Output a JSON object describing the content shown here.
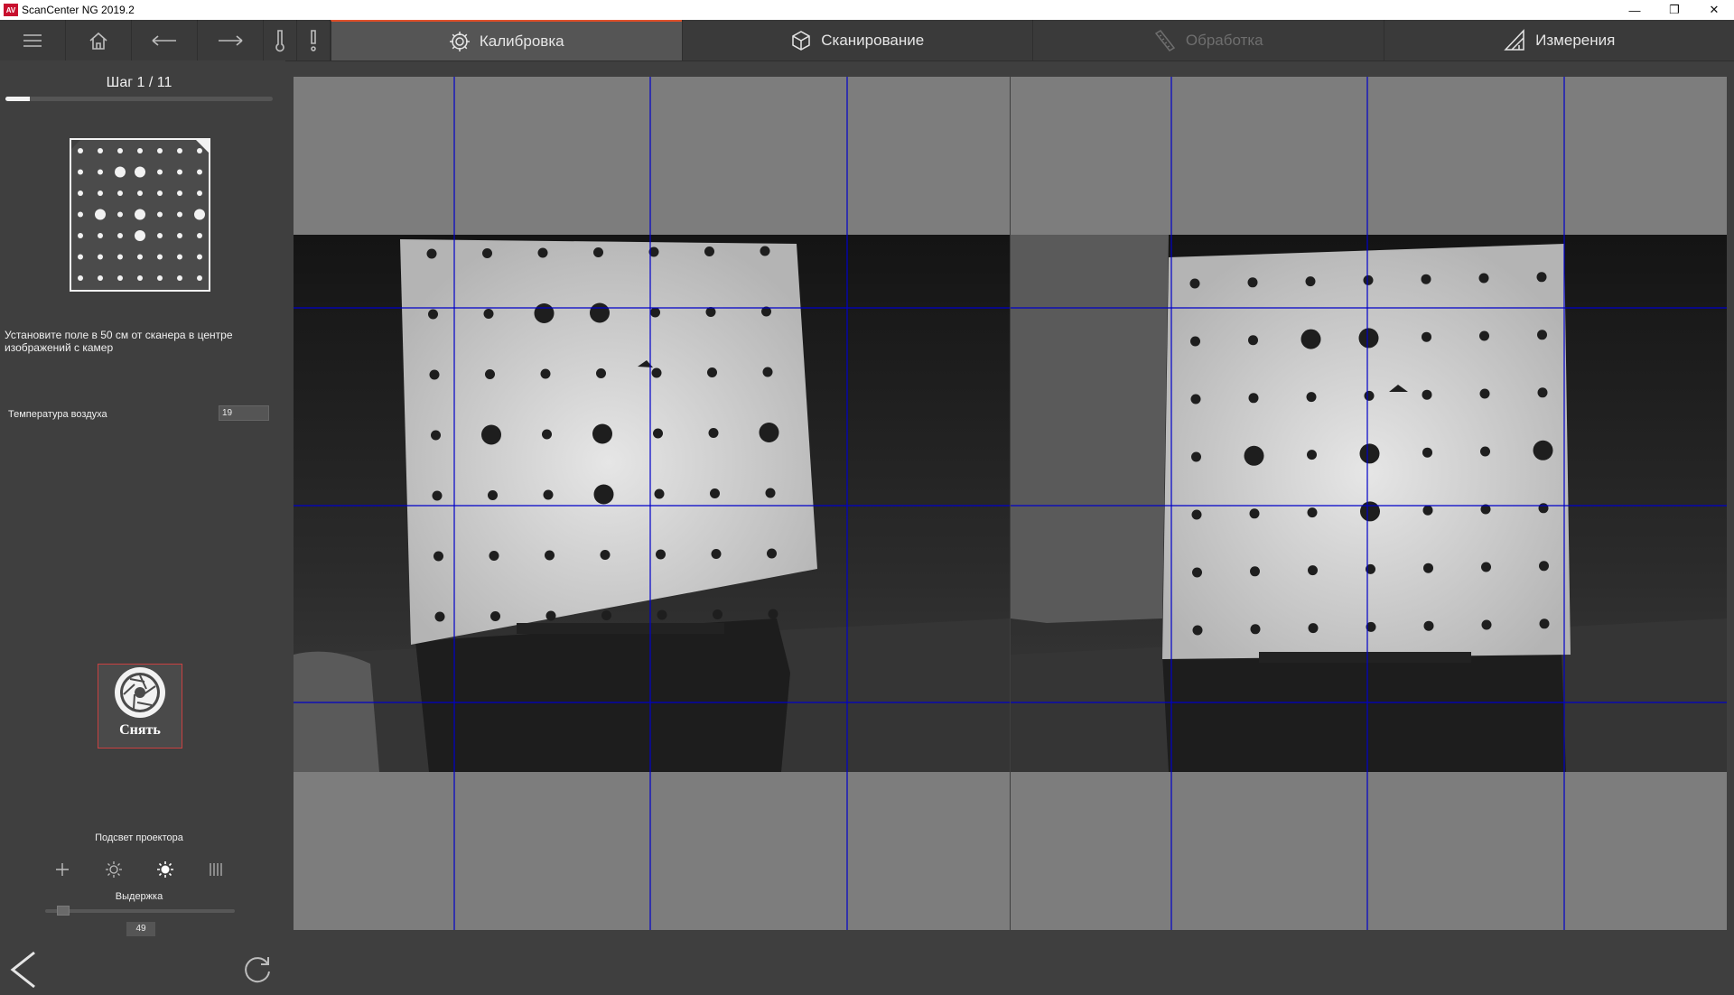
{
  "window": {
    "title": "ScanCenter NG 2019.2",
    "logo_text": "AV"
  },
  "toolbar": {
    "buttons": [
      {
        "icon": "menu-icon"
      },
      {
        "icon": "home-icon"
      },
      {
        "icon": "undo-icon"
      },
      {
        "icon": "redo-icon"
      },
      {
        "icon": "thermometer-icon"
      },
      {
        "icon": "exclamation-icon"
      }
    ],
    "tabs": [
      {
        "label": "Калибровка",
        "icon": "gear-icon",
        "state": "active"
      },
      {
        "label": "Сканирование",
        "icon": "cube-icon",
        "state": "normal"
      },
      {
        "label": "Обработка",
        "icon": "ruler-icon",
        "state": "disabled"
      },
      {
        "label": "Измерения",
        "icon": "triangle-ruler-icon",
        "state": "normal"
      }
    ]
  },
  "calibration": {
    "step_label": "Шаг 1 / 11",
    "progress": 0.09,
    "instruction": "Установите поле в 50 см от сканера в центре изображений с камер",
    "temperature_label": "Температура воздуха",
    "temperature_value": "19",
    "capture_label": "Снять",
    "projector_light_label": "Подсвет проектора",
    "light_modes": [
      "plus-icon",
      "sun-dim-icon",
      "sun-bright-icon",
      "stripes-icon"
    ],
    "exposure_label": "Выдержка",
    "exposure_value": "49",
    "exposure_level": 0.06
  },
  "colors": {
    "accent": "#e0502a",
    "capture_border": "#c94141",
    "guide_lines": "#0000c8",
    "panel": "#3f3f3f"
  }
}
